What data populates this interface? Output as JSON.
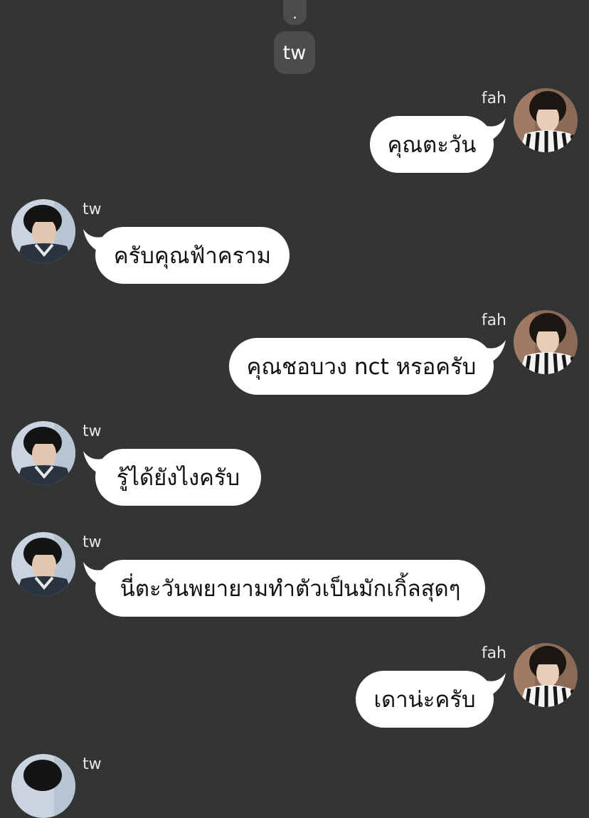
{
  "chat": {
    "top_fragment": ".",
    "center_label": "tw",
    "colors": {
      "background": "#323533",
      "bubble": "#ffffff",
      "bubble_text": "#111111",
      "name_text": "#e6e6e6",
      "pill": "#4b4d4c"
    },
    "messages": [
      {
        "sender": "fah",
        "text": "คุณตะวัน"
      },
      {
        "sender": "tw",
        "text": "ครับคุณฟ้าคราม"
      },
      {
        "sender": "fah",
        "text": "คุณชอบวง nct หรอครับ"
      },
      {
        "sender": "tw",
        "text": "รู้ได้ยังไงครับ"
      },
      {
        "sender": "tw",
        "text": "นี่ตะวันพยายามทำตัวเป็นมักเกิ้ลสุดๆ"
      },
      {
        "sender": "fah",
        "text": "เดาน่ะครับ"
      },
      {
        "sender": "tw"
      }
    ]
  }
}
